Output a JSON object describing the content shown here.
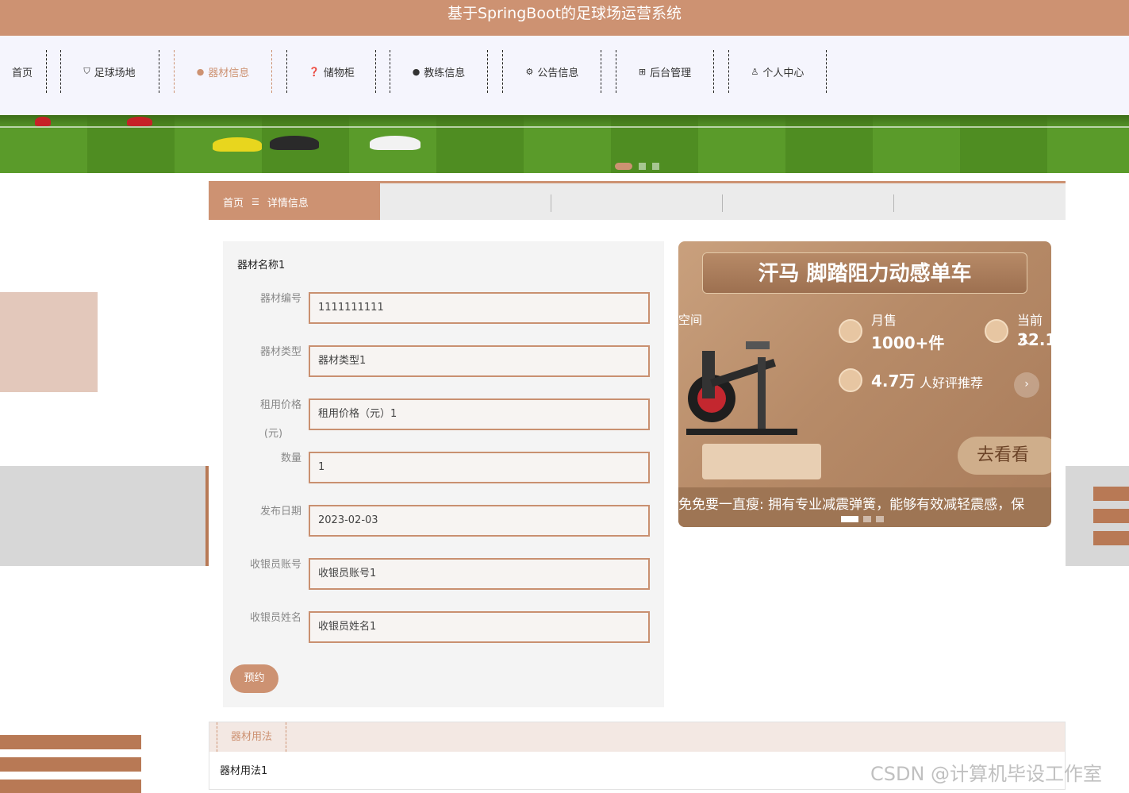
{
  "app": {
    "title": "基于SpringBoot的足球场运营系统"
  },
  "nav": {
    "items": [
      {
        "label": "首页",
        "icon": "",
        "active": false
      },
      {
        "label": "足球场地",
        "icon": "bag-icon",
        "active": false
      },
      {
        "label": "器材信息",
        "icon": "info-icon",
        "active": true
      },
      {
        "label": "储物柜",
        "icon": "help-icon",
        "active": false
      },
      {
        "label": "教练信息",
        "icon": "info-icon",
        "active": false
      },
      {
        "label": "公告信息",
        "icon": "gear-icon",
        "active": false
      },
      {
        "label": "后台管理",
        "icon": "gift-icon",
        "active": false
      },
      {
        "label": "个人中心",
        "icon": "user-icon",
        "active": false
      }
    ]
  },
  "breadcrumb": {
    "home": "首页",
    "separator": "☰",
    "current": "详情信息"
  },
  "form": {
    "title": "器材名称1",
    "fields": {
      "equipment_no": {
        "label": "器材编号",
        "value": "1111111111"
      },
      "equipment_type": {
        "label": "器材类型",
        "value": "器材类型1"
      },
      "rent_price": {
        "label": "租用价格",
        "label_unit": "(元)",
        "value": "租用价格（元）1"
      },
      "quantity": {
        "label": "数量",
        "value": "1"
      },
      "publish_date": {
        "label": "发布日期",
        "value": "2023-02-03"
      },
      "cashier_account": {
        "label": "收银员账号",
        "value": "收银员账号1"
      },
      "cashier_name": {
        "label": "收银员姓名",
        "value": "收银员姓名1"
      }
    },
    "reserve_button": "预约"
  },
  "ad": {
    "title": "汗马 脚踏阻力动感单车",
    "monthly_sales_label": "月售",
    "monthly_sales_value": "1000+件",
    "current_label": "当前人",
    "current_value": "32.1",
    "rating_value": "4.7万",
    "rating_label": "人好评推荐",
    "side_text": "空间",
    "cta": "去看看",
    "footer": "免免要一直瘦: 拥有专业减震弹簧，能够有效减轻震感，保"
  },
  "usage": {
    "tab": "器材用法",
    "content": "器材用法1"
  },
  "watermark": "CSDN @计算机毕设工作室",
  "colors": {
    "accent": "#cd9272",
    "nav_bg": "#f5f5fd",
    "input_border": "#c99070"
  }
}
